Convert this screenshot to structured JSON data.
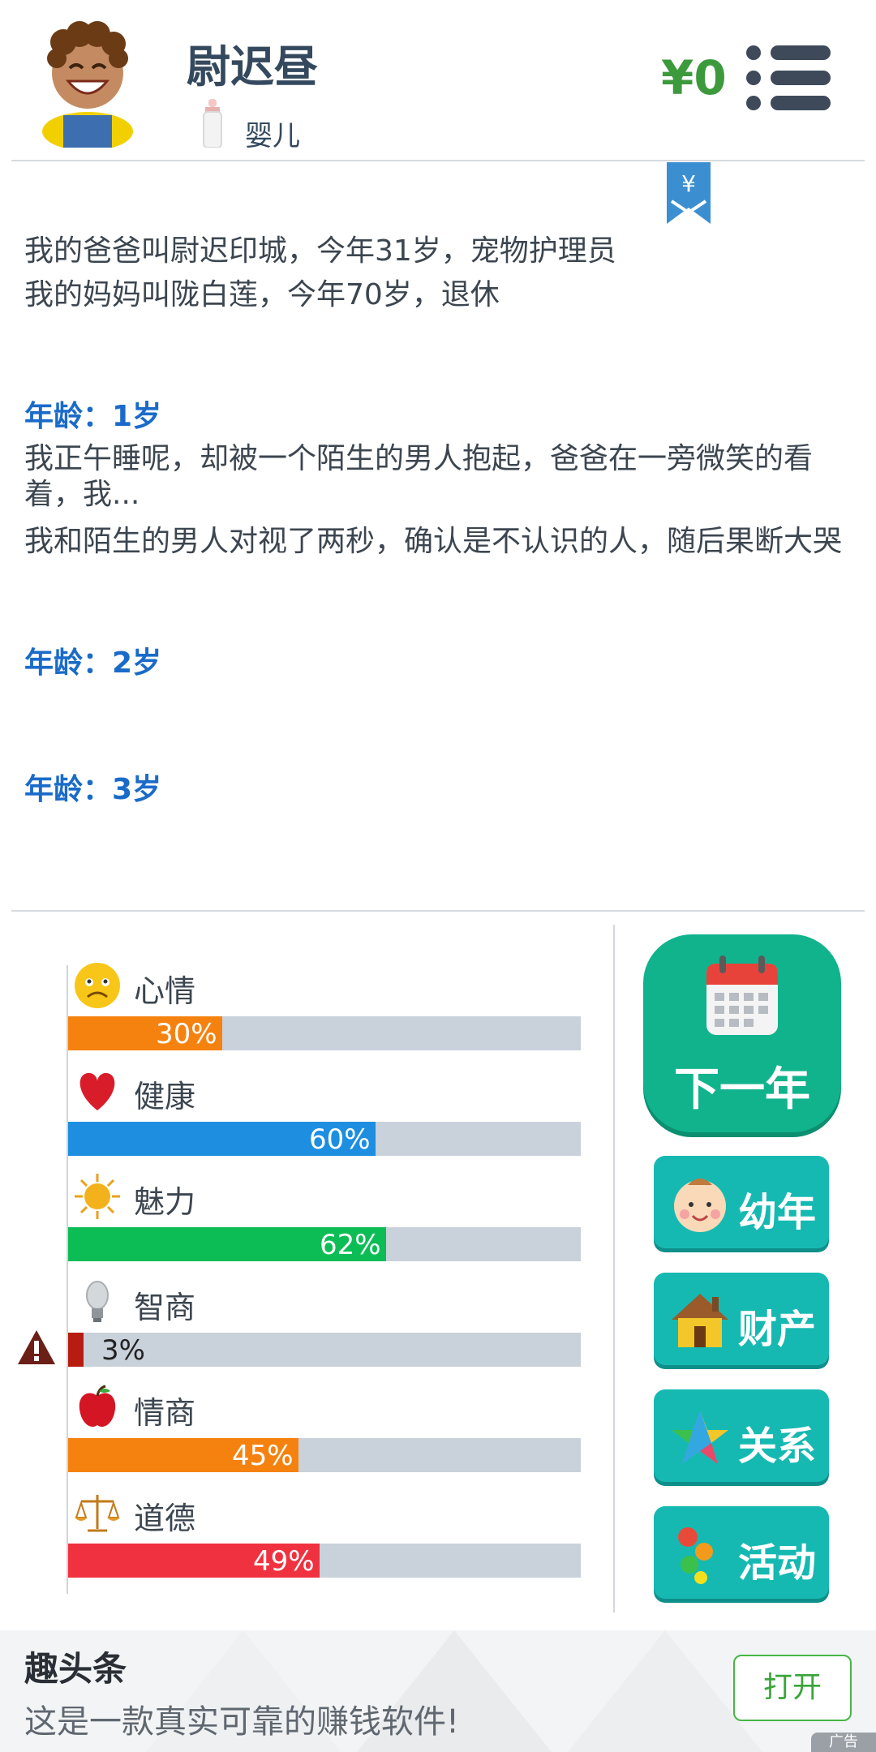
{
  "header": {
    "player_name": "尉迟昼",
    "stage_label": "婴儿",
    "money": "¥0"
  },
  "bookmark_symbol": "¥",
  "story": {
    "intro": [
      "我的爸爸叫尉迟印城，今年31岁，宠物护理员",
      "我的妈妈叫陇白莲，今年70岁，退休"
    ],
    "age1_head": "年龄：1岁",
    "age1_lines": [
      "我正午睡呢，却被一个陌生的男人抱起，爸爸在一旁微笑的看着，我...",
      "我和陌生的男人对视了两秒，确认是不认识的人，随后果断大哭"
    ],
    "age2_head": "年龄：2岁",
    "age3_head": "年龄：3岁"
  },
  "stats": [
    {
      "label": "心情",
      "value": 30,
      "text": "30%",
      "color": "#f5820f",
      "icon": "sad-face-icon"
    },
    {
      "label": "健康",
      "value": 60,
      "text": "60%",
      "color": "#1d8ee0",
      "icon": "heart-icon"
    },
    {
      "label": "魅力",
      "value": 62,
      "text": "62%",
      "color": "#0cbd55",
      "icon": "sun-icon"
    },
    {
      "label": "智商",
      "value": 3,
      "text": "3%",
      "color": "#b71c10",
      "icon": "lightbulb-icon"
    },
    {
      "label": "情商",
      "value": 45,
      "text": "45%",
      "color": "#f5820f",
      "icon": "apple-icon"
    },
    {
      "label": "道德",
      "value": 49,
      "text": "49%",
      "color": "#f03240",
      "icon": "scales-icon"
    }
  ],
  "actions": {
    "next_year": "下一年",
    "childhood": "幼年",
    "property": "财产",
    "relations": "关系",
    "activities": "活动"
  },
  "ad": {
    "title": "趣头条",
    "description": "这是一款真实可靠的赚钱软件!",
    "open_label": "打开",
    "tag": "广告"
  },
  "colors": {
    "next_button": "#10b38c",
    "side_button": "#16b9b2",
    "age_heading": "#1a6bc9",
    "money": "#3c9a3c"
  }
}
